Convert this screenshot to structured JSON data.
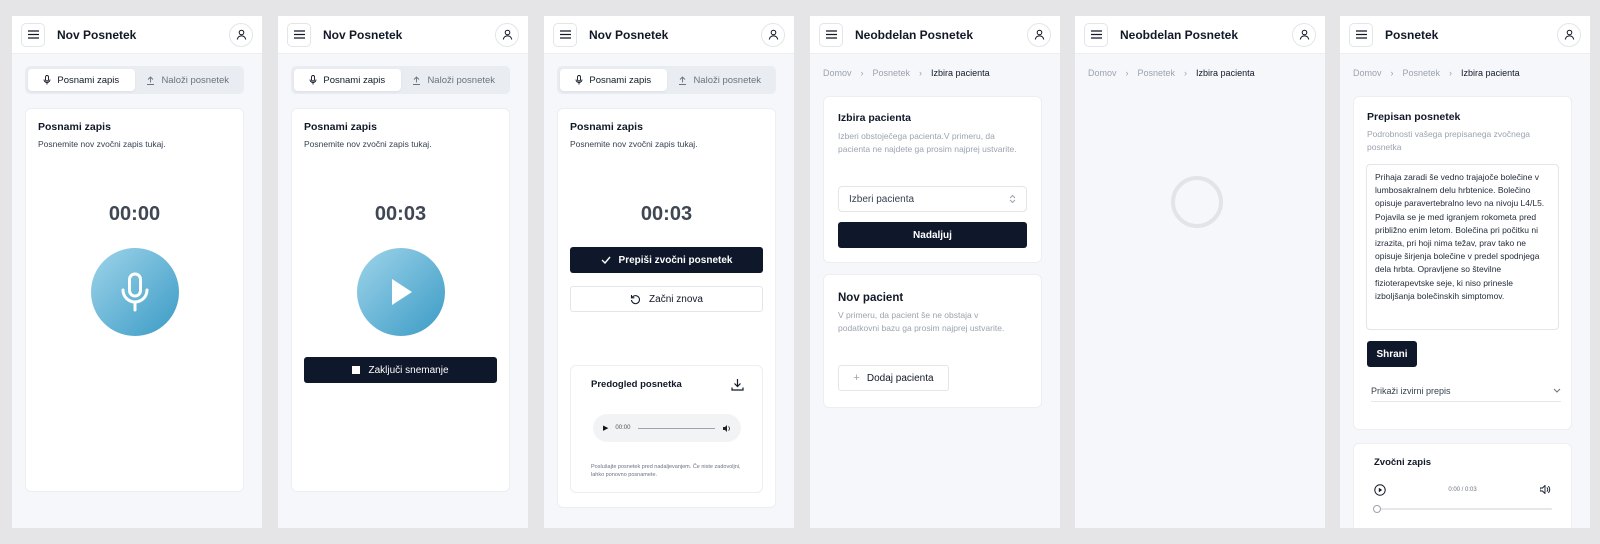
{
  "screens": [
    {
      "title": "Nov Posnetek",
      "tabs": [
        "Posnami zapis",
        "Naloži posnetek"
      ],
      "card_title": "Posnami zapis",
      "card_desc": "Posnemite nov zvočni zapis tukaj.",
      "timer": "00:00"
    },
    {
      "title": "Nov Posnetek",
      "tabs": [
        "Posnami zapis",
        "Naloži posnetek"
      ],
      "card_title": "Posnami zapis",
      "card_desc": "Posnemite nov zvočni zapis tukaj.",
      "timer": "00:03",
      "stop_label": "Zaključi snemanje"
    },
    {
      "title": "Nov Posnetek",
      "tabs": [
        "Posnami zapis",
        "Naloži posnetek"
      ],
      "card_title": "Posnami zapis",
      "card_desc": "Posnemite nov zvočni zapis tukaj.",
      "timer": "00:03",
      "transcribe_label": "Prepiši zvočni posnetek",
      "restart_label": "Začni znova",
      "preview_title": "Predogled posnetka",
      "player_time": "00:00",
      "preview_note": "Poslušajte posnetek pred nadaljevanjem. Če niste zadovoljni, lahko ponovno posnamete."
    },
    {
      "title": "Neobdelan Posnetek",
      "breadcrumb": [
        "Domov",
        "Posnetek",
        "Izbira pacienta"
      ],
      "select_title": "Izbira pacienta",
      "select_desc": "Izberi obstoječega pacienta.V primeru, da pacienta ne najdete ga prosim najprej ustvarite.",
      "select_placeholder": "Izberi pacienta",
      "continue_label": "Nadaljuj",
      "new_title": "Nov pacient",
      "new_desc": "V primeru, da pacient še ne obstaja v podatkovni bazu ga prosim najprej ustvarite.",
      "add_label": "Dodaj pacienta"
    },
    {
      "title": "Neobdelan Posnetek",
      "breadcrumb": [
        "Domov",
        "Posnetek",
        "Izbira pacienta"
      ]
    },
    {
      "title": "Posnetek",
      "breadcrumb": [
        "Domov",
        "Posnetek",
        "Izbira pacienta"
      ],
      "transcript_title": "Prepisan posnetek",
      "transcript_desc": "Podrobnosti vašega prepisanega zvočnega posnetka",
      "transcript_text": "Prihaja zaradi še vedno trajajoče bolečine v lumbosakralnem delu hrbtenice. Bolečino opisuje paravertebralno levo na nivoju L4/L5. Pojavila se je med igranjem rokometa pred približno enim letom. Bolečina pri počitku ni izrazita, pri hoji nima težav, prav tako ne opisuje širjenja bolečine v predel spodnjega dela hrbta. Opravljene so številne fizioterapevtske seje, ki niso prinesle izboljšanja bolečinskih simptomov.",
      "save_label": "Shrani",
      "show_original_label": "Prikaži izvirni prepis",
      "audio_title": "Zvočni zapis",
      "audio_time": "0:00 / 0:03"
    }
  ],
  "colors": {
    "primary": "#0f172a",
    "accent_light": "#9fd4ea",
    "accent_dark": "#3a9bc5",
    "background": "#f5f7fa"
  }
}
